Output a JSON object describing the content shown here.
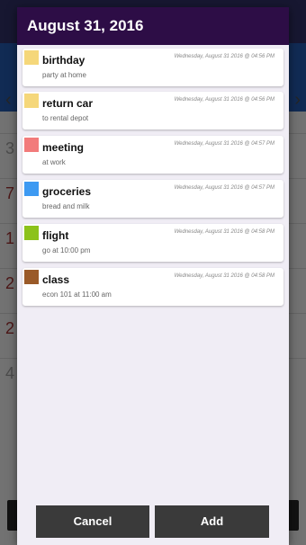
{
  "dialog": {
    "title": "August 31, 2016",
    "cancel_label": "Cancel",
    "add_label": "Add"
  },
  "events": [
    {
      "title": "birthday",
      "subtitle": "party at home",
      "time": "Wednesday, August 31 2016 @ 04:56 PM",
      "color": "#f5d77a"
    },
    {
      "title": "return car",
      "subtitle": "to rental depot",
      "time": "Wednesday, August 31 2016 @ 04:56 PM",
      "color": "#f5d77a"
    },
    {
      "title": "meeting",
      "subtitle": "at work",
      "time": "Wednesday, August 31 2016 @ 04:57 PM",
      "color": "#f27b7b"
    },
    {
      "title": "groceries",
      "subtitle": "bread and milk",
      "time": "Wednesday, August 31 2016 @ 04:57 PM",
      "color": "#3d9af2"
    },
    {
      "title": "flight",
      "subtitle": "go at 10:00 pm",
      "time": "Wednesday, August 31 2016 @ 04:58 PM",
      "color": "#8cc21a"
    },
    {
      "title": "class",
      "subtitle": "econ 101 at 11:00 am",
      "time": "Wednesday, August 31 2016 @ 04:58 PM",
      "color": "#9a5a28"
    }
  ]
}
